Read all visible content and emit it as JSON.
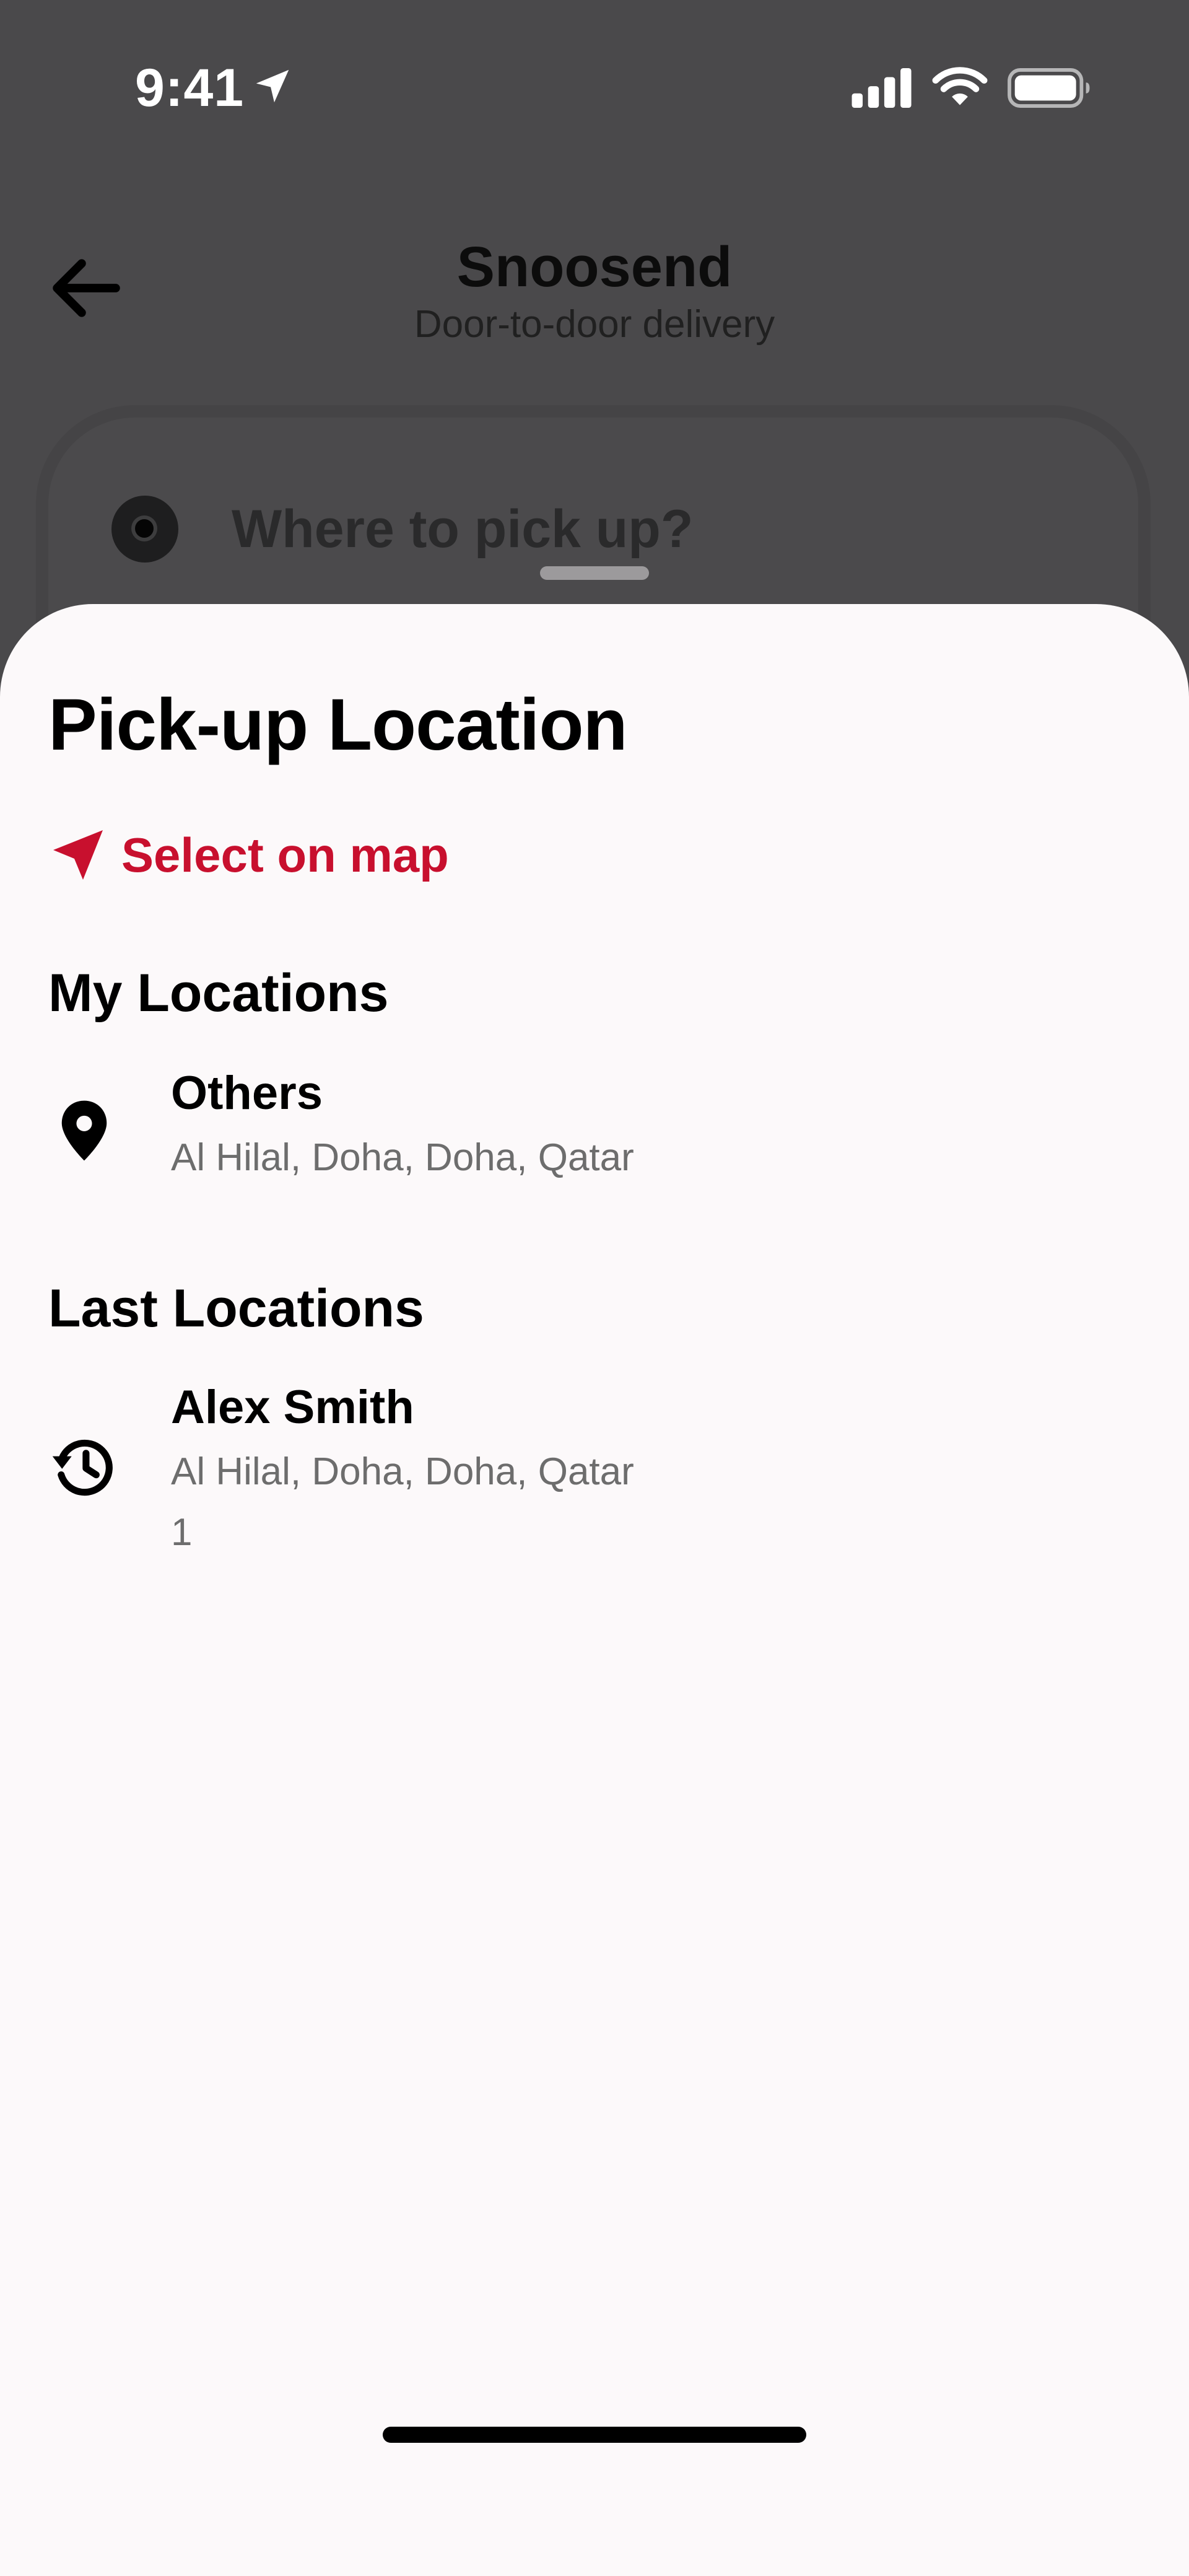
{
  "status_bar": {
    "time": "9:41",
    "icons": [
      "location-arrow-icon",
      "cellular-signal-icon",
      "wifi-icon",
      "battery-icon"
    ]
  },
  "header": {
    "title": "Snoosend",
    "subtitle": "Door-to-door delivery",
    "back_icon": "back-arrow-icon"
  },
  "pickup_field": {
    "placeholder": "Where to pick up?"
  },
  "sheet": {
    "title": "Pick-up Location",
    "select_on_map": {
      "label": "Select on map",
      "icon": "navigation-arrow-icon",
      "color": "#c8102e"
    },
    "my_locations": {
      "heading": "My Locations",
      "items": [
        {
          "name": "Others",
          "address": "Al Hilal, Doha, Doha, Qatar",
          "icon": "map-pin-icon"
        }
      ]
    },
    "last_locations": {
      "heading": "Last Locations",
      "items": [
        {
          "name": "Alex Smith",
          "address": "Al Hilal, Doha, Doha, Qatar",
          "extra": "1",
          "icon": "history-icon"
        }
      ]
    }
  },
  "colors": {
    "accent": "#c8102e",
    "overlay": "#4a494b",
    "sheet_background": "#fcf9fa",
    "secondary_text": "#6d6d6d"
  }
}
